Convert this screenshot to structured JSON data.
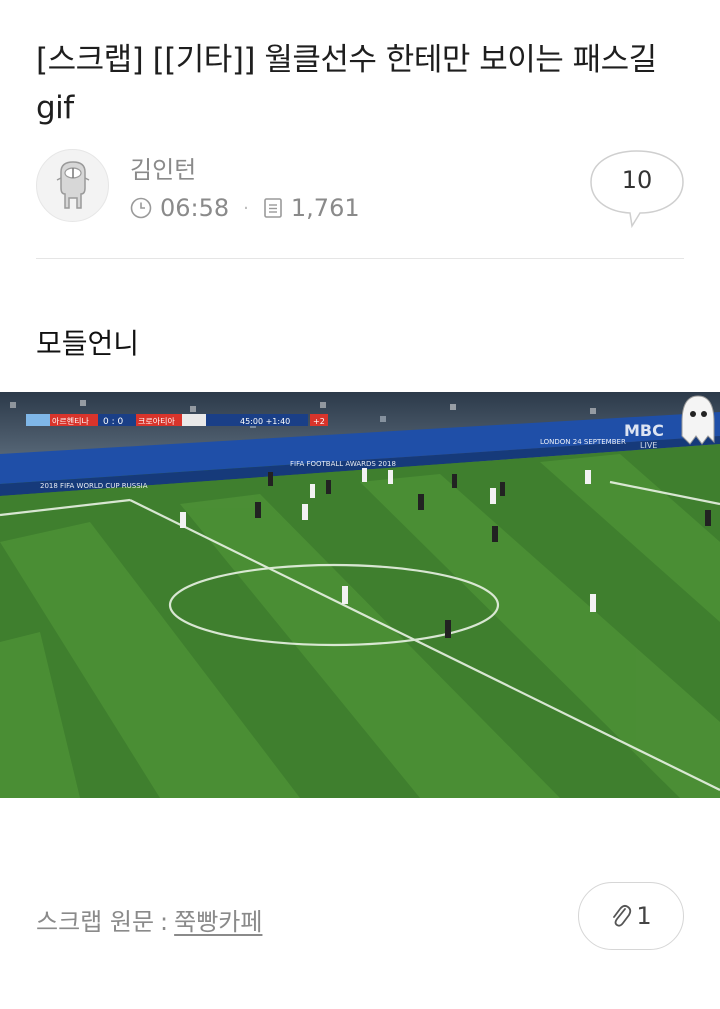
{
  "post": {
    "title": "[스크랩] [[기타]] 월클선수 한테만 보이는 패스길 gif",
    "author": "김인턴",
    "time": "06:58",
    "views": "1,761",
    "comment_count": "10",
    "body_text": "모들언니"
  },
  "media": {
    "scoreboard": {
      "team_a": "아르헨티나",
      "score": "0 : 0",
      "team_b": "크로아티아",
      "clock": "45:00 +1:40",
      "extra": "+2"
    },
    "board_texts": [
      "2018 FIFA WORLD CUP RUSSIA",
      "FIFA FOOTBALL AWARDS 2018",
      "LONDON 24 SEPTEMBER",
      "LIVE"
    ],
    "broadcaster": "MBC"
  },
  "footer": {
    "source_label": "스크랩 원문",
    "separator": ":",
    "source_link": "쭉빵카페",
    "clip_count": "1"
  },
  "colors": {
    "meta_gray": "#8a8a8a",
    "grass_dark": "#3a7a2a",
    "grass_light": "#4e9336"
  }
}
